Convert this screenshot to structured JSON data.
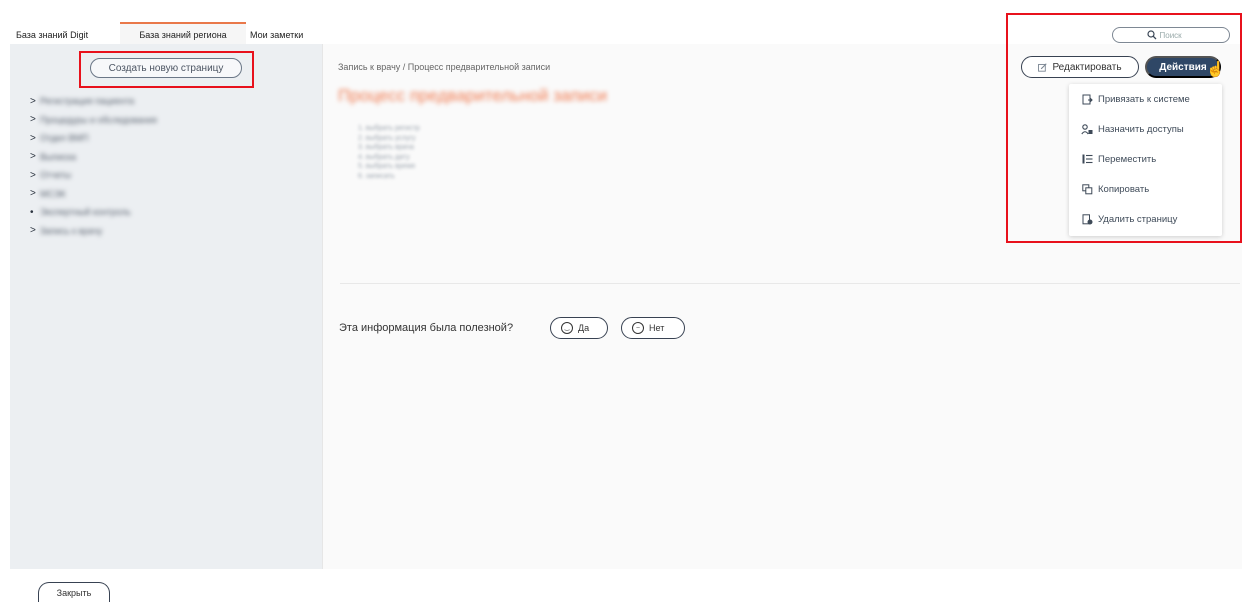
{
  "tabs": [
    {
      "label": "База знаний Digit"
    },
    {
      "label": "База знаний региона",
      "active": true
    },
    {
      "label": "Мои заметки"
    }
  ],
  "sidebar": {
    "create_button_label": "Создать новую страницу",
    "tree_items": [
      {
        "marker": ">",
        "label": "Регистрация пациента"
      },
      {
        "marker": ">",
        "label": "Процедуры и обследования"
      },
      {
        "marker": ">",
        "label": "Отдел ВМП"
      },
      {
        "marker": ">",
        "label": "Выписка"
      },
      {
        "marker": ">",
        "label": "Отчеты"
      },
      {
        "marker": ">",
        "label": "МСЭК"
      },
      {
        "marker": "•",
        "label": "Экспертный контроль"
      },
      {
        "marker": ">",
        "label": "Запись к врачу"
      }
    ]
  },
  "search": {
    "placeholder": "Поиск"
  },
  "main": {
    "breadcrumb": "Запись к врачу / Процесс предварительной записи",
    "title": "Процесс предварительной записи",
    "content_lines": [
      "1. выбрать регистр",
      "2. выбрать услугу",
      "3. выбрать врача",
      "4. выбрать дату",
      "5. выбрать время",
      "6. записать"
    ],
    "feedback": {
      "question": "Эта информация была полезной?",
      "yes_label": "Да",
      "no_label": "Нет"
    }
  },
  "toolbar": {
    "edit_label": "Редактировать",
    "actions_label": "Действия"
  },
  "actions_menu": [
    {
      "label": "Привязать к системе",
      "icon": "link-system-icon"
    },
    {
      "label": "Назначить доступы",
      "icon": "assign-access-icon"
    },
    {
      "label": "Переместить",
      "icon": "move-icon"
    },
    {
      "label": "Копировать",
      "icon": "copy-icon"
    },
    {
      "label": "Удалить страницу",
      "icon": "delete-page-icon"
    }
  ],
  "footer": {
    "close_label": "Закрыть"
  },
  "colors": {
    "accent": "#f07b51",
    "primary_button": "#2f4766",
    "highlight": "#e8111c",
    "sidebar_bg": "#eceff2"
  }
}
